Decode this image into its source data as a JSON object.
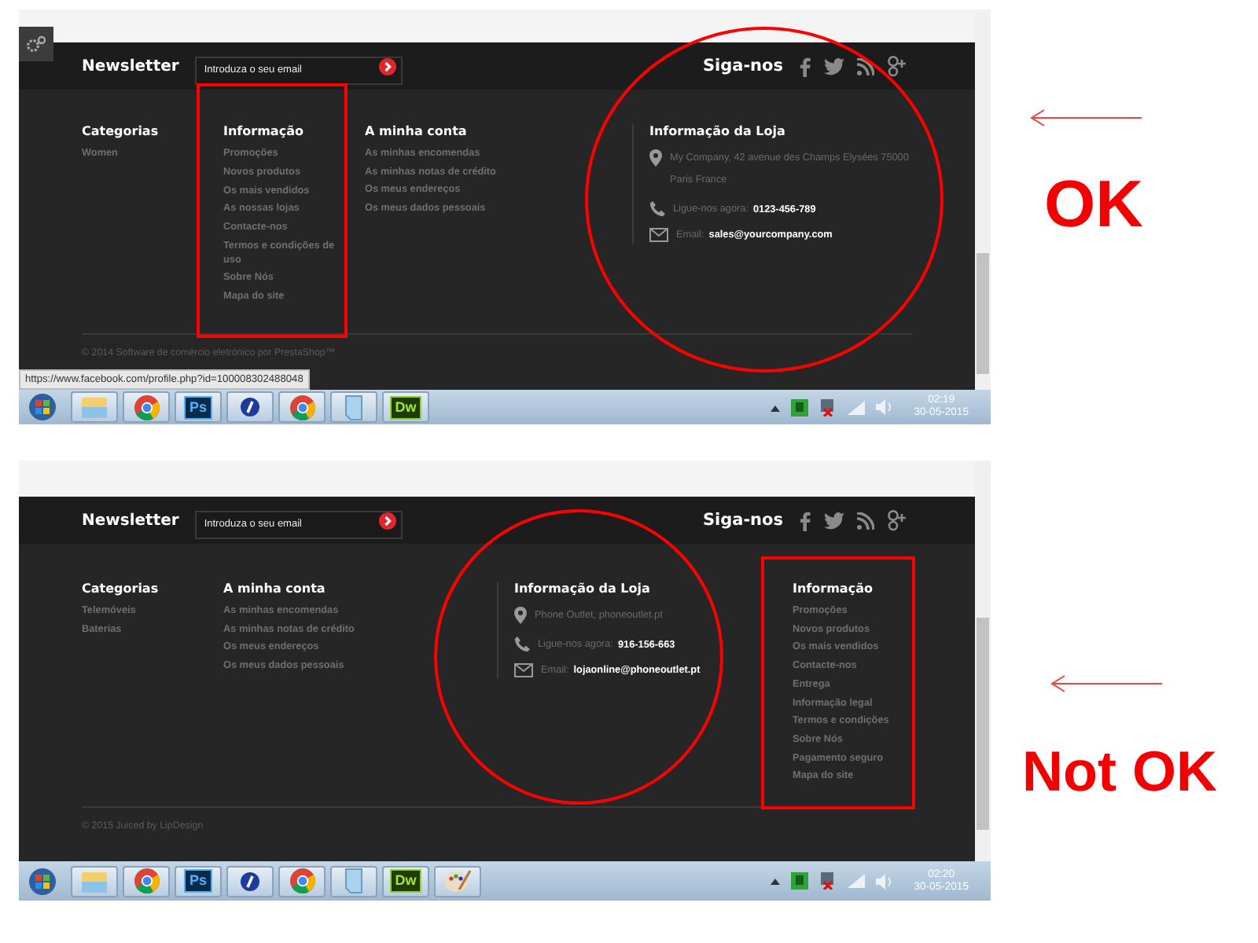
{
  "screenshots": [
    {
      "verdict": "OK",
      "settings_button": true,
      "newsletter": {
        "title": "Newsletter",
        "placeholder": "Introduza o seu email"
      },
      "follow": "Siga-nos",
      "columns": [
        {
          "kind": "links",
          "title": "Categorias",
          "boxed": false,
          "circled": false,
          "items": [
            "Women"
          ]
        },
        {
          "kind": "links",
          "title": "Informação",
          "boxed": true,
          "circled": false,
          "items": [
            "Promoções",
            "Novos produtos",
            "Os mais vendidos",
            "As nossas lojas",
            "Contacte-nos",
            "Termos e condições de uso",
            "Sobre Nós",
            "Mapa do site"
          ]
        },
        {
          "kind": "links",
          "title": "A minha conta",
          "boxed": false,
          "circled": false,
          "items": [
            "As minhas encomendas",
            "As minhas notas de crédito",
            "Os meus endereços",
            "Os meus dados pessoais"
          ]
        },
        {
          "kind": "store",
          "title": "Informação da Loja",
          "boxed": false,
          "circled": true,
          "address": "My Company, 42 avenue des Champs Elysées 75000 Paris France",
          "phone_label": "Ligue-nos agora:",
          "phone": "0123-456-789",
          "email_label": "Email:",
          "email": "sales@yourcompany.com"
        }
      ],
      "copyright": "© 2014 Software de comércio eletrónico por PrestaShop™",
      "status_url": "https://www.facebook.com/profile.php?id=100008302488048",
      "taskbar": {
        "apps": [
          {
            "kind": "explorer"
          },
          {
            "kind": "chrome"
          },
          {
            "kind": "photoshop",
            "label": "Ps"
          },
          {
            "kind": "app"
          },
          {
            "kind": "chrome"
          },
          {
            "kind": "notepad"
          },
          {
            "kind": "dreamweaver",
            "label": "Dw"
          }
        ],
        "time": "02:19",
        "date": "30-05-2015"
      }
    },
    {
      "verdict": "Not OK",
      "settings_button": false,
      "newsletter": {
        "title": "Newsletter",
        "placeholder": "Introduza o seu email"
      },
      "follow": "Siga-nos",
      "columns": [
        {
          "kind": "links",
          "title": "Categorias",
          "boxed": false,
          "circled": false,
          "items": [
            "Telemóveis",
            "Baterias"
          ]
        },
        {
          "kind": "links",
          "title": "A minha conta",
          "boxed": false,
          "circled": false,
          "items": [
            "As minhas encomendas",
            "As minhas notas de crédito",
            "Os meus endereços",
            "Os meus dados pessoais"
          ]
        },
        {
          "kind": "store",
          "title": "Informação da Loja",
          "boxed": false,
          "circled": true,
          "address": "Phone Outlet, phoneoutlet.pt",
          "phone_label": "Ligue-nos agora:",
          "phone": "916-156-663",
          "email_label": "Email:",
          "email": "lojaonline@phoneoutlet.pt"
        },
        {
          "kind": "links",
          "title": "Informação",
          "boxed": true,
          "circled": false,
          "items": [
            "Promoções",
            "Novos produtos",
            "Os mais vendidos",
            "Contacte-nos",
            "Entrega",
            "Informação legal",
            "Termos e condições",
            "Sobre Nós",
            "Pagamento seguro",
            "Mapa do site"
          ]
        }
      ],
      "copyright": "© 2015 Juiced by LipDesign",
      "taskbar": {
        "apps": [
          {
            "kind": "explorer"
          },
          {
            "kind": "chrome"
          },
          {
            "kind": "photoshop",
            "label": "Ps"
          },
          {
            "kind": "app"
          },
          {
            "kind": "chrome"
          },
          {
            "kind": "notepad"
          },
          {
            "kind": "dreamweaver",
            "label": "Dw"
          },
          {
            "kind": "paint"
          }
        ],
        "time": "02:20",
        "date": "30-05-2015"
      }
    }
  ]
}
